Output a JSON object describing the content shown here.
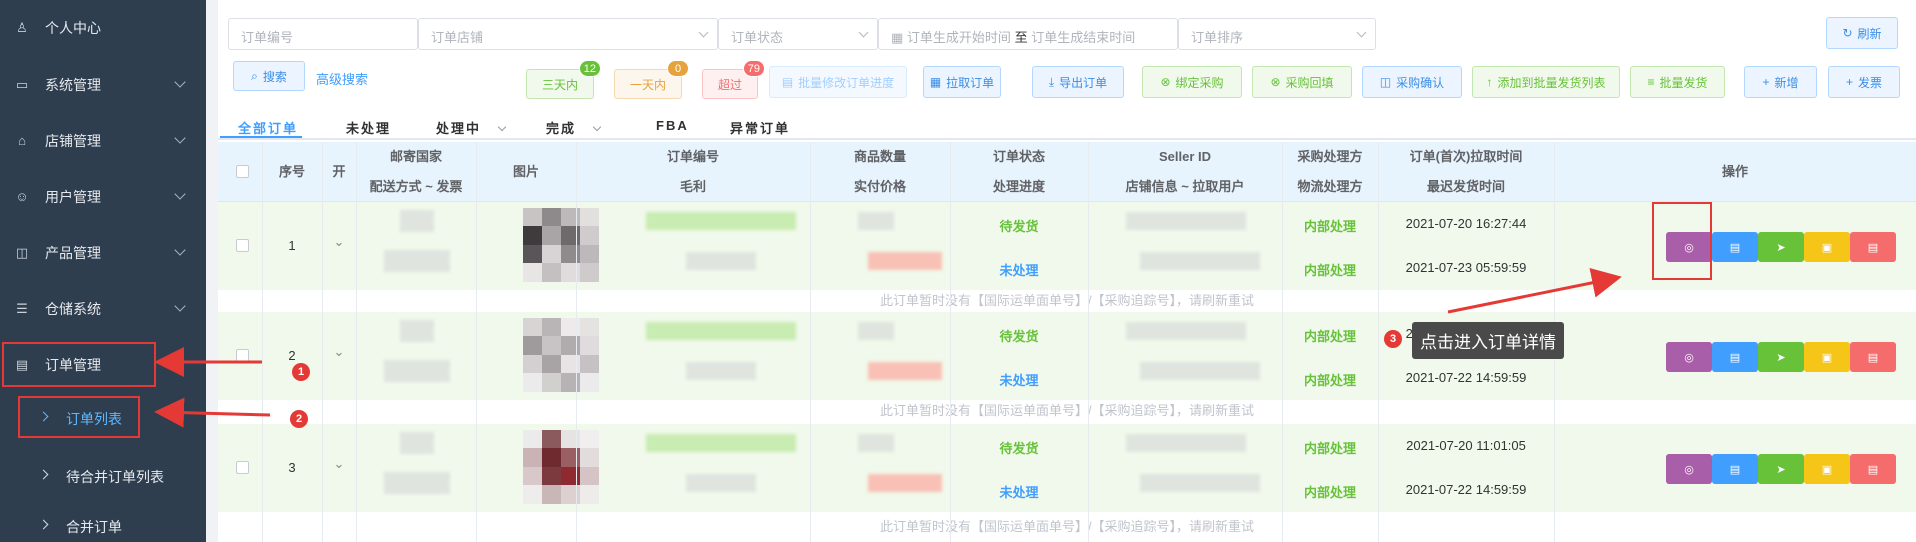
{
  "sidebar": {
    "items": [
      {
        "label": "个人中心",
        "icon": "user-icon"
      },
      {
        "label": "系统管理",
        "icon": "monitor-icon"
      },
      {
        "label": "店铺管理",
        "icon": "shop-icon"
      },
      {
        "label": "用户管理",
        "icon": "users-icon"
      },
      {
        "label": "产品管理",
        "icon": "bag-icon"
      },
      {
        "label": "仓储系统",
        "icon": "list-icon"
      },
      {
        "label": "订单管理",
        "icon": "document-icon"
      }
    ],
    "sub_items": [
      {
        "label": "订单列表"
      },
      {
        "label": "待合并订单列表"
      },
      {
        "label": "合并订单"
      }
    ]
  },
  "filters": {
    "order_no_placeholder": "订单编号",
    "shop_placeholder": "订单店铺",
    "status_placeholder": "订单状态",
    "start_time_placeholder": "订单生成开始时间",
    "range_sep": "至",
    "end_time_placeholder": "订单生成结束时间",
    "sort_placeholder": "订单排序",
    "refresh_label": "刷新",
    "search_label": "搜索",
    "advanced_search_label": "高级搜索"
  },
  "quick_filters": [
    {
      "label": "三天内",
      "count": "12",
      "color": "#67c23a"
    },
    {
      "label": "一天内",
      "count": "0",
      "color": "#e6a23c"
    },
    {
      "label": "超过",
      "count": "79",
      "color": "#f56c6c"
    }
  ],
  "toolbar": {
    "batch_progress_label": "批量修改订单进度",
    "pull_label": "拉取订单",
    "export_label": "导出订单",
    "bind_purchase_label": "绑定采购",
    "purchase_fill_label": "采购回填",
    "purchase_confirm_label": "采购确认",
    "add_batch_ship_label": "添加到批量发货列表",
    "batch_ship_label": "批量发货",
    "add_label": "新增",
    "ship_label": "发票"
  },
  "tabs": [
    "全部订单",
    "未处理",
    "处理中",
    "完成",
    "FBA",
    "异常订单"
  ],
  "table": {
    "headers": {
      "index": "序号",
      "open": "开",
      "country": "邮寄国家",
      "shipping": "配送方式 ~ 发票",
      "image": "图片",
      "order_no": "订单编号",
      "profit": "毛利",
      "qty": "商品数量",
      "paid": "实付价格",
      "status": "订单状态",
      "progress": "处理进度",
      "seller": "Seller ID",
      "shop_info": "店铺信息 ~ 拉取用户",
      "purchase_handler": "采购处理方",
      "logistics_handler": "物流处理方",
      "pull_time": "订单(首次)拉取时间",
      "last_ship": "最迟发货时间",
      "actions": "操作"
    },
    "rows": [
      {
        "index": "1",
        "status": "待发货",
        "progress": "未处理",
        "purchase": "内部处理",
        "logistics": "内部处理",
        "pull_time": "2021-07-20 16:27:44",
        "last_ship": "2021-07-23 05:59:59"
      },
      {
        "index": "2",
        "status": "待发货",
        "progress": "未处理",
        "purchase": "内部处理",
        "logistics": "内部处理",
        "pull_time": "2021-07-20 13:03:02",
        "last_ship": "2021-07-22 14:59:59"
      },
      {
        "index": "3",
        "status": "待发货",
        "progress": "未处理",
        "purchase": "内部处理",
        "logistics": "内部处理",
        "pull_time": "2021-07-20 11:01:05",
        "last_ship": "2021-07-22 14:59:59"
      }
    ],
    "note": "此订单暂时没有【国际运单面单号】/【采购追踪号】，请刷新重试"
  },
  "annotations": {
    "steps": [
      "1",
      "2",
      "3"
    ],
    "tooltip": "点击进入订单详情",
    "accent": "#e53935"
  }
}
